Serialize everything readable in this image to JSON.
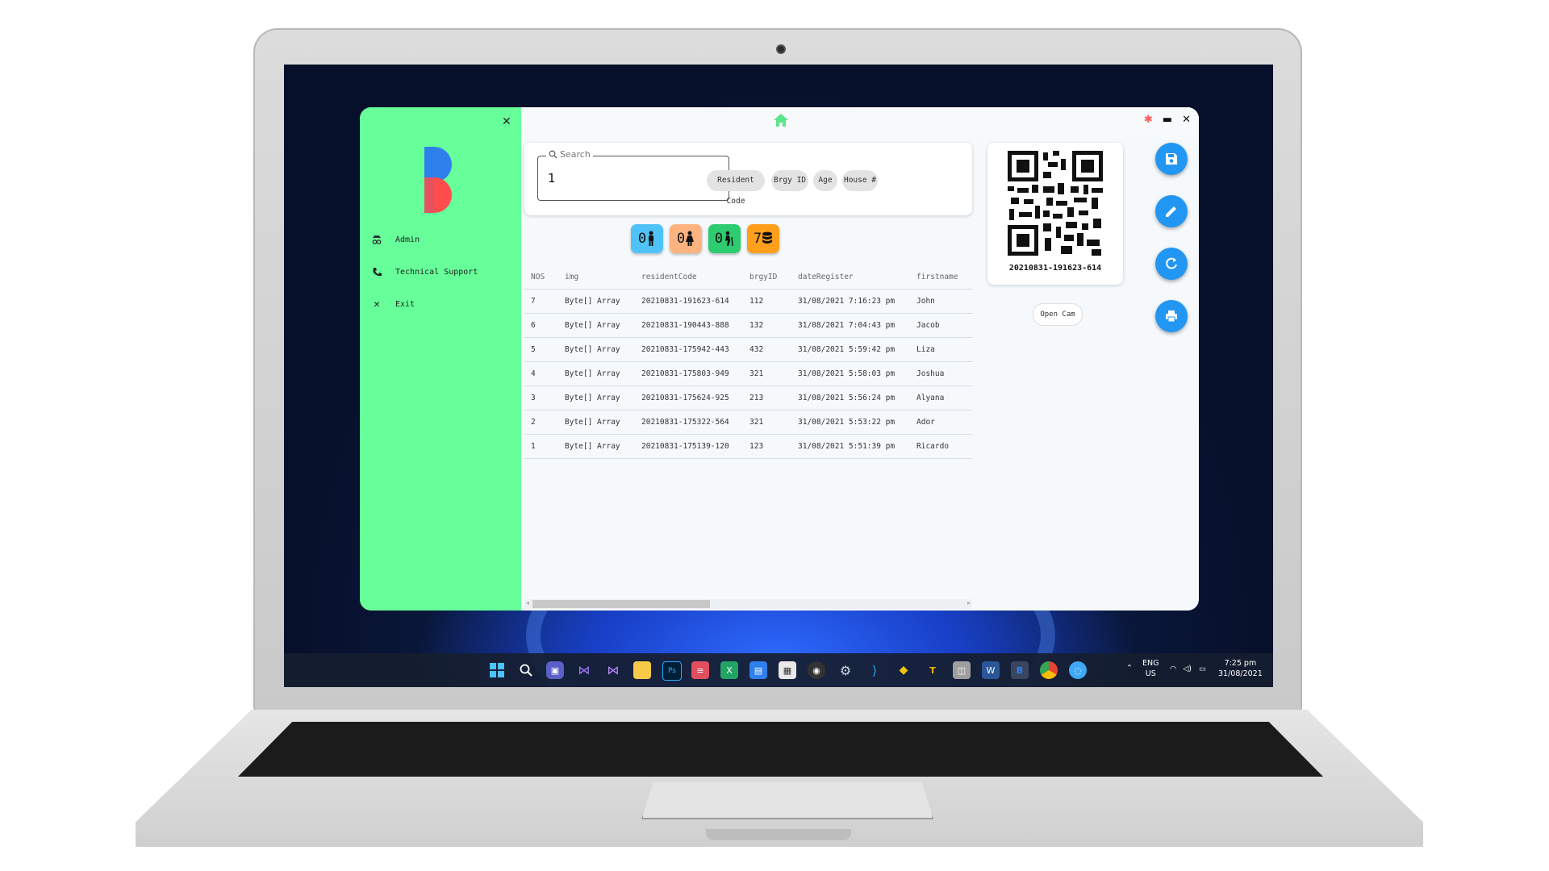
{
  "app": {
    "sidebar": {
      "items": [
        {
          "label": "Admin",
          "icon": "admin-icon"
        },
        {
          "label": "Technical Support",
          "icon": "phone-icon"
        },
        {
          "label": "Exit",
          "icon": "close-icon"
        }
      ],
      "color": "#66ff99"
    },
    "search": {
      "legend": "Search",
      "value": "1",
      "chips": [
        "Resident Code",
        "Brgy ID",
        "Age",
        "House #"
      ]
    },
    "stats": [
      {
        "value": "0",
        "icon": "male-icon",
        "color": "#4fc3f7"
      },
      {
        "value": "0",
        "icon": "female-icon",
        "color": "#ffb380"
      },
      {
        "value": "0",
        "icon": "elderly-icon",
        "color": "#2ecc71"
      },
      {
        "value": "7",
        "icon": "database-icon",
        "color": "#ff9f1c"
      }
    ],
    "table": {
      "columns": [
        "NOS",
        "img",
        "residentCode",
        "brgyID",
        "dateRegister",
        "firstname"
      ],
      "rows": [
        [
          "7",
          "Byte[] Array",
          "20210831-191623-614",
          "112",
          "31/08/2021 7:16:23 pm",
          "John"
        ],
        [
          "6",
          "Byte[] Array",
          "20210831-190443-888",
          "132",
          "31/08/2021 7:04:43 pm",
          "Jacob"
        ],
        [
          "5",
          "Byte[] Array",
          "20210831-175942-443",
          "432",
          "31/08/2021 5:59:42 pm",
          "Liza"
        ],
        [
          "4",
          "Byte[] Array",
          "20210831-175803-949",
          "321",
          "31/08/2021 5:58:03 pm",
          "Joshua"
        ],
        [
          "3",
          "Byte[] Array",
          "20210831-175624-925",
          "213",
          "31/08/2021 5:56:24 pm",
          "Alyana"
        ],
        [
          "2",
          "Byte[] Array",
          "20210831-175322-564",
          "321",
          "31/08/2021 5:53:22 pm",
          "Ador"
        ],
        [
          "1",
          "Byte[] Array",
          "20210831-175139-120",
          "123",
          "31/08/2021 5:51:39 pm",
          "Ricardo"
        ]
      ]
    },
    "qr": {
      "code": "20210831-191623-614"
    },
    "open_cam_label": "Open Cam",
    "actions": [
      "save-icon",
      "edit-icon",
      "refresh-icon",
      "print-icon"
    ],
    "accent": "#2196f3"
  },
  "taskbar": {
    "lang": "ENG",
    "region": "US",
    "time": "7:25 pm",
    "date": "31/08/2021"
  }
}
